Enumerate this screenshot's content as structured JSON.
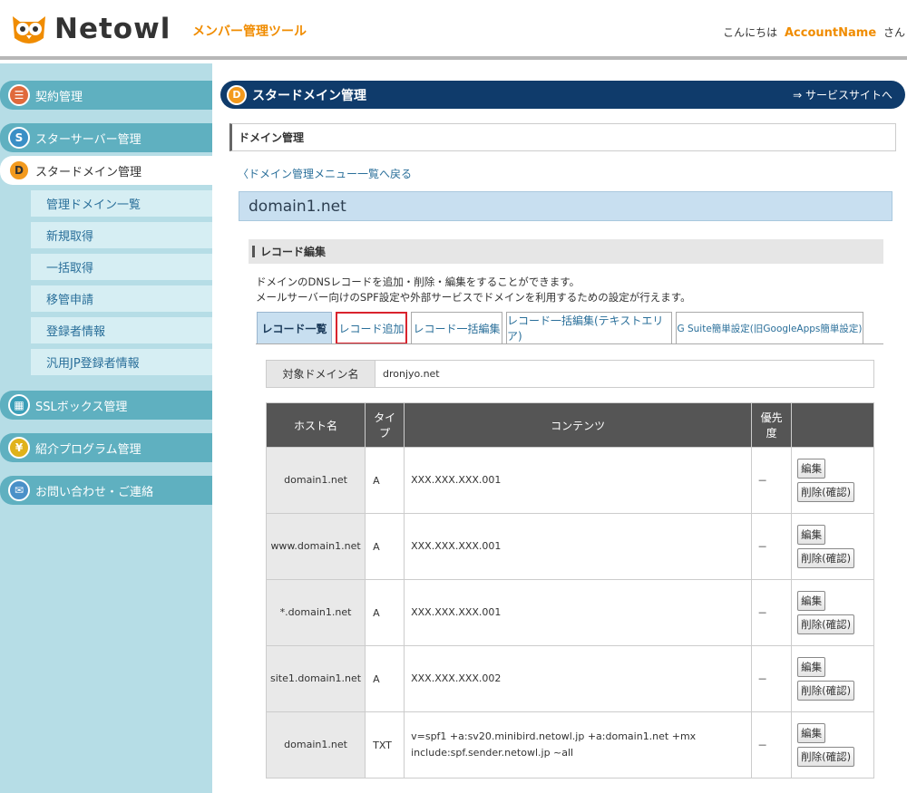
{
  "header": {
    "logo_text": "Netowl",
    "tool_name": "メンバー管理ツール",
    "greeting_prefix": "こんにちは",
    "account_name": "AccountName",
    "greeting_suffix": "さん"
  },
  "sidebar": {
    "items": [
      {
        "label": "契約管理",
        "icon": "contract-icon"
      },
      {
        "label": "スターサーバー管理",
        "icon": "star-server-icon"
      },
      {
        "label": "スタードメイン管理",
        "icon": "star-domain-icon"
      },
      {
        "label": "SSLボックス管理",
        "icon": "ssl-box-icon"
      },
      {
        "label": "紹介プログラム管理",
        "icon": "yen-icon"
      },
      {
        "label": "お問い合わせ・ご連絡",
        "icon": "mail-icon"
      }
    ],
    "subitems": [
      "管理ドメイン一覧",
      "新規取得",
      "一括取得",
      "移管申請",
      "登録者情報",
      "汎用JP登録者情報"
    ]
  },
  "banner": {
    "title": "スタードメイン管理",
    "link": "⇒ サービスサイトへ"
  },
  "section_title": "ドメイン管理",
  "back_link": "〈ドメイン管理メニュー一覧へ戻る",
  "domain": "domain1.net",
  "record_edit": {
    "heading": "レコード編集",
    "desc1": "ドメインのDNSレコードを追加・削除・編集をすることができます。",
    "desc2": "メールサーバー向けのSPF設定や外部サービスでドメインを利用するための設定が行えます。"
  },
  "tabs": [
    "レコード一覧",
    "レコード追加",
    "レコード一括編集",
    "レコード一括編集(テキストエリア)",
    "G Suite簡単設定(旧GoogleApps簡単設定)"
  ],
  "target": {
    "label": "対象ドメイン名",
    "value": "dronjyo.net"
  },
  "table": {
    "headers": [
      "ホスト名",
      "タイプ",
      "コンテンツ",
      "優先度",
      ""
    ],
    "edit_label": "編集",
    "delete_label": "削除(確認)",
    "rows": [
      {
        "host": "domain1.net",
        "type": "A",
        "content": "XXX.XXX.XXX.001",
        "priority": "－"
      },
      {
        "host": "www.domain1.net",
        "type": "A",
        "content": "XXX.XXX.XXX.001",
        "priority": "－"
      },
      {
        "host": "*.domain1.net",
        "type": "A",
        "content": "XXX.XXX.XXX.001",
        "priority": "－"
      },
      {
        "host": "site1.domain1.net",
        "type": "A",
        "content": "XXX.XXX.XXX.002",
        "priority": "－"
      },
      {
        "host": "domain1.net",
        "type": "TXT",
        "content": "v=spf1 +a:sv20.minibird.netowl.jp +a:domain1.net +mx include:spf.sender.netowl.jp ~all",
        "priority": "－"
      }
    ]
  },
  "colors": {
    "accent": "#f08c00",
    "sidebar": "#5fb0c0",
    "banner": "#0f3b6b",
    "highlight": "#d9232d"
  }
}
